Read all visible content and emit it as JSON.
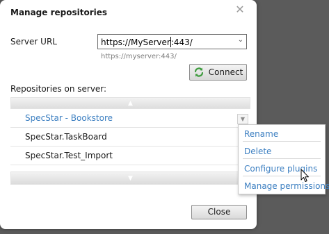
{
  "dialog": {
    "title": "Manage repositories",
    "close_glyph": "✕"
  },
  "server": {
    "label": "Server URL",
    "url_before_caret": "https://MyServer",
    "url_after_caret": ":443/",
    "hint": "https://myserver:443/",
    "dropdown_icon": "chevron-down-icon"
  },
  "connect": {
    "label": "Connect",
    "icon": "refresh-icon",
    "icon_color": "#3d9b3d"
  },
  "repositories": {
    "label": "Repositories on server:",
    "scroll_up_glyph": "▲",
    "scroll_down_glyph": "▼",
    "items": [
      {
        "name": "SpecStar - Bookstore",
        "selected": true
      },
      {
        "name": "SpecStar.TaskBoard",
        "selected": false
      },
      {
        "name": "SpecStar.Test_Import",
        "selected": false
      }
    ],
    "row_dropdown_glyph": "▼"
  },
  "context_menu": {
    "items": [
      {
        "label": "Rename"
      },
      {
        "label": "Delete"
      },
      {
        "label": "Configure plugins"
      },
      {
        "label": "Manage permissions"
      }
    ],
    "link_color": "#3c7fc1"
  },
  "footer": {
    "close_label": "Close"
  }
}
